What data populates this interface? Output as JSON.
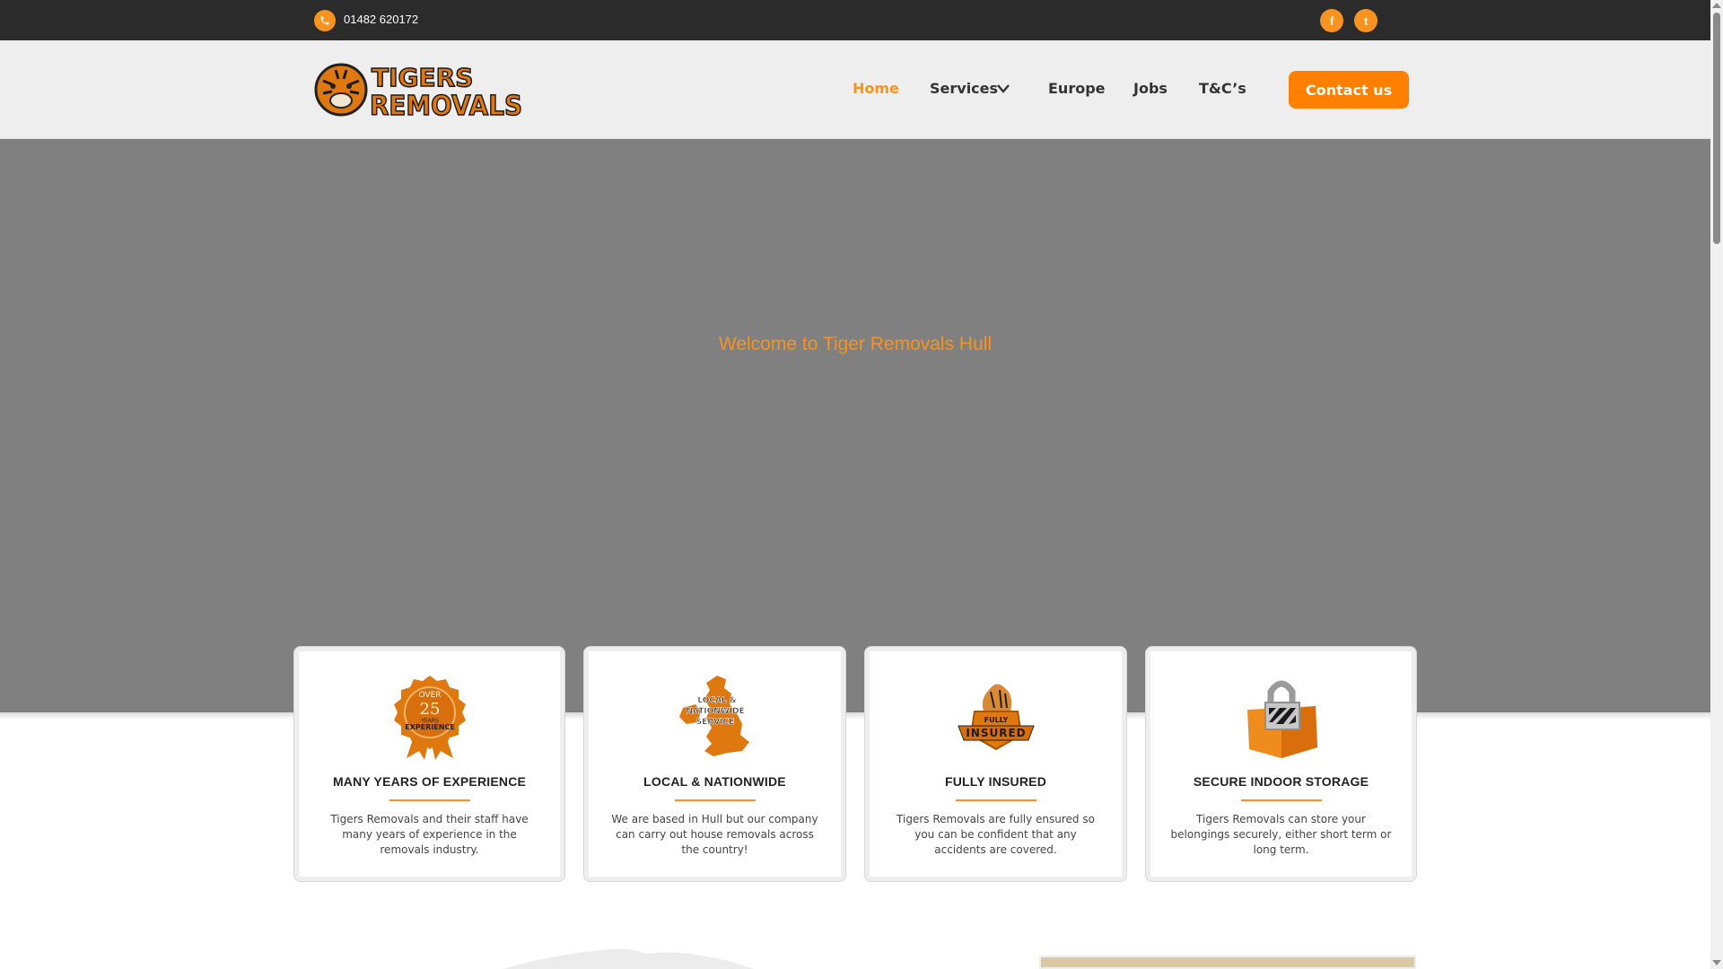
{
  "topbar": {
    "phone": "01482 620172",
    "phone_icon": "phone-icon",
    "social": [
      {
        "name": "facebook-icon",
        "glyph": "f"
      },
      {
        "name": "twitter-icon",
        "glyph": "t"
      }
    ]
  },
  "header": {
    "logo_line1": "TIGERS",
    "logo_line2": "REMOVALS",
    "nav": [
      {
        "label": "Home",
        "active": true
      },
      {
        "label": "Services"
      },
      {
        "label": "Europe"
      },
      {
        "label": "Jobs"
      },
      {
        "label": "T&C’s"
      }
    ],
    "contact_label": "Contact us"
  },
  "hero": {
    "title": "Welcome to Tiger Removals Hull"
  },
  "cards": [
    {
      "badge_text": [
        "OVER",
        "25",
        "YEARS",
        "EXPERIENCE"
      ],
      "title": "MANY YEARS OF EXPERIENCE",
      "text": "Tigers Removals and their staff have many years of experience in the removals industry."
    },
    {
      "badge_text": [
        "LOCAL &",
        "NATIONWIDE",
        "SERVICE"
      ],
      "title": "LOCAL & NATIONWIDE",
      "text": "We are based in Hull but our company can carry out house removals across the country!"
    },
    {
      "badge_text": [
        "FULLY",
        "INSURED"
      ],
      "title": "FULLY INSURED",
      "text": "Tigers Removals are fully ensured so you can be confident that any accidents are covered."
    },
    {
      "title": "SECURE INDOOR STORAGE",
      "text": "Tigers Removals can store your belongings securely, either short term or long term."
    }
  ],
  "colors": {
    "accent": "#f7931e",
    "button": "#ff7f00",
    "topbar": "#2b2b2b",
    "header": "#eeeeee",
    "hero": "#808080"
  }
}
